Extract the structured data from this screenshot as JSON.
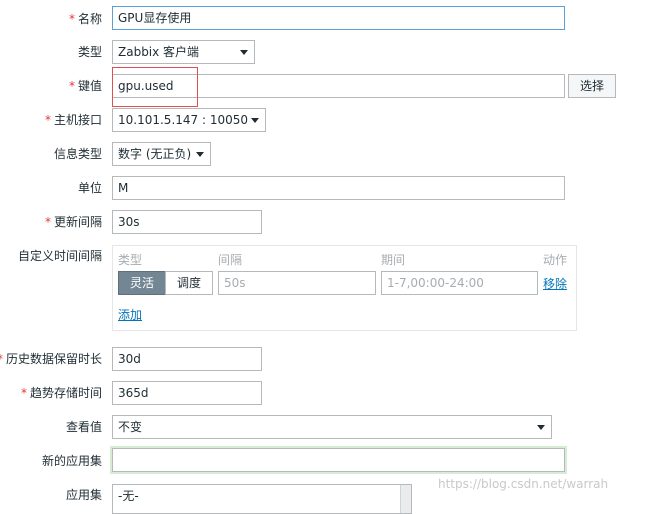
{
  "form": {
    "name": {
      "label": "名称",
      "value": "GPU显存使用"
    },
    "type": {
      "label": "类型",
      "value": "Zabbix 客户端"
    },
    "key": {
      "label": "键值",
      "value": "gpu.used",
      "select_button": "选择"
    },
    "host_interface": {
      "label": "主机接口",
      "value": "10.101.5.147 : 10050"
    },
    "info_type": {
      "label": "信息类型",
      "value": "数字 (无正负)"
    },
    "units": {
      "label": "单位",
      "value": "M"
    },
    "update_interval": {
      "label": "更新间隔",
      "value": "30s"
    },
    "custom_intervals": {
      "label": "自定义时间间隔",
      "headers": {
        "type": "类型",
        "interval": "间隔",
        "period": "期间",
        "action": "动作"
      },
      "row": {
        "mode_flexible": "灵活",
        "mode_scheduling": "调度",
        "interval_placeholder": "50s",
        "period_placeholder": "1-7,00:00-24:00",
        "remove": "移除"
      },
      "add": "添加"
    },
    "history": {
      "label": "历史数据保留时长",
      "value": "30d"
    },
    "trends": {
      "label": "趋势存储时间",
      "value": "365d"
    },
    "show_value": {
      "label": "查看值",
      "value": "不变"
    },
    "new_application": {
      "label": "新的应用集",
      "value": ""
    },
    "applications": {
      "label": "应用集",
      "first_option": "-无-"
    }
  },
  "required_mark": "*",
  "watermark": "https://blog.csdn.net/warrah",
  "colors": {
    "required": "#e33734",
    "link": "#0275b8",
    "active_segment": "#738694",
    "highlight": "#e05050"
  }
}
